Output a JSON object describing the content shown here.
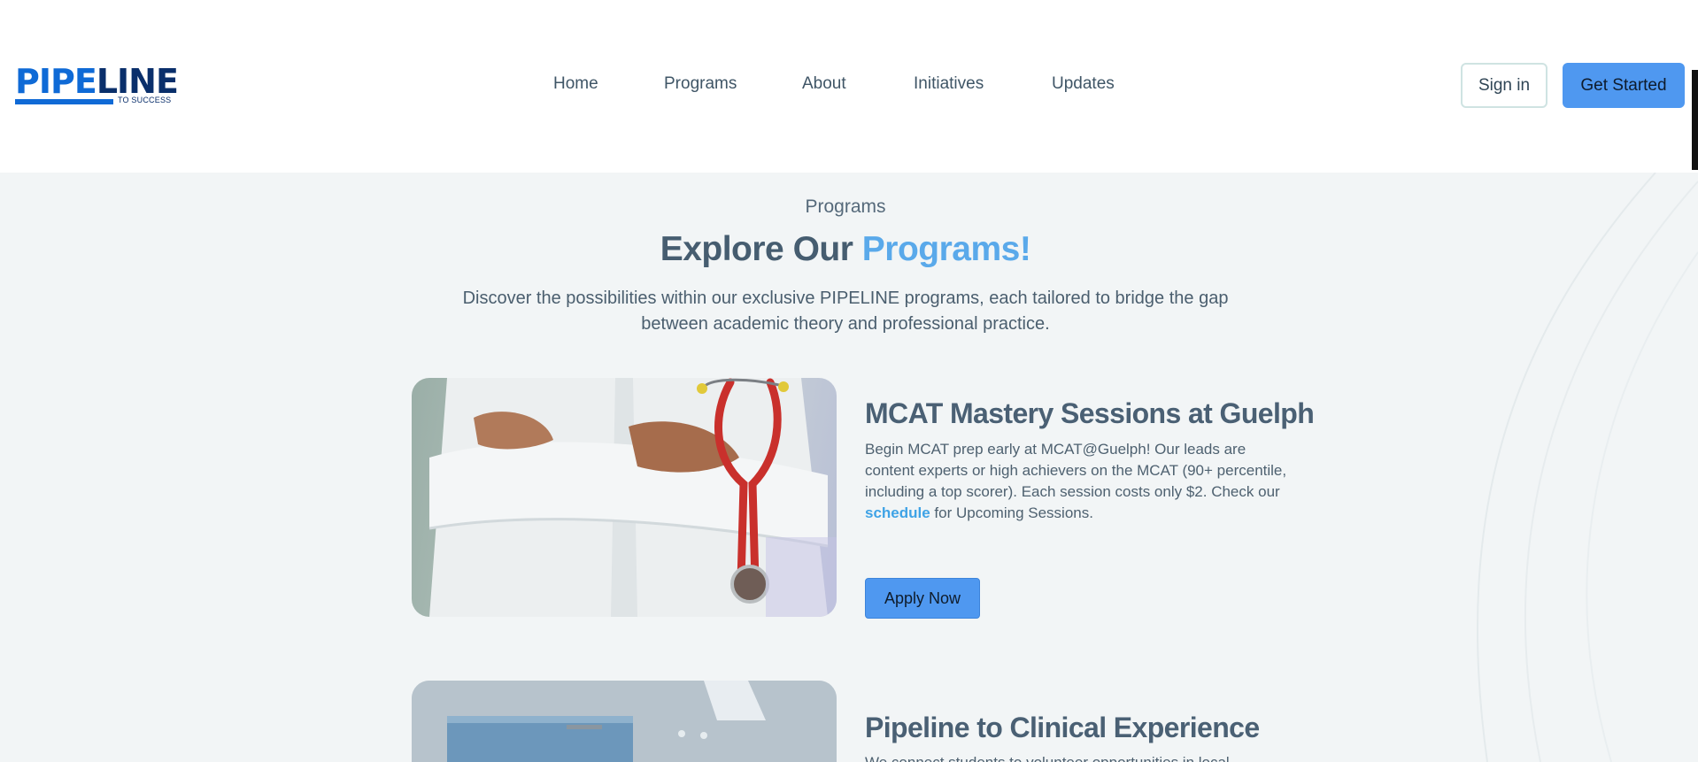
{
  "header": {
    "logo": {
      "main_left": "PIPE",
      "main_right": "LINE",
      "subtitle": "TO SUCCESS"
    },
    "nav": {
      "home": "Home",
      "programs": "Programs",
      "about": "About",
      "initiatives": "Initiatives",
      "updates": "Updates"
    },
    "sign_in": "Sign in",
    "get_started": "Get Started"
  },
  "section": {
    "eyebrow": "Programs",
    "headline_plain": "Explore Our ",
    "headline_accent": "Programs!",
    "intro": "Discover the possibilities within our exclusive PIPELINE programs, each tailored to bridge the gap between academic theory and professional practice."
  },
  "programs": [
    {
      "title": "MCAT Mastery Sessions at Guelph",
      "desc_before": "Begin MCAT prep early at MCAT@Guelph! Our leads are content experts or high achievers on the MCAT (90+ percentile, including a top scorer). Each session costs only $2. Check our ",
      "desc_link": "schedule",
      "desc_after": " for Upcoming Sessions.",
      "button": "Apply Now"
    },
    {
      "title": "Pipeline to Clinical Experience",
      "desc_partial": "We connect students to volunteer opportunities in local"
    }
  ],
  "colors": {
    "primary": "#4f98f0",
    "accent_text": "#5aa9ea",
    "logo_blue": "#0f6ad6",
    "logo_navy": "#0a2f6b",
    "background": "#f2f5f6"
  }
}
